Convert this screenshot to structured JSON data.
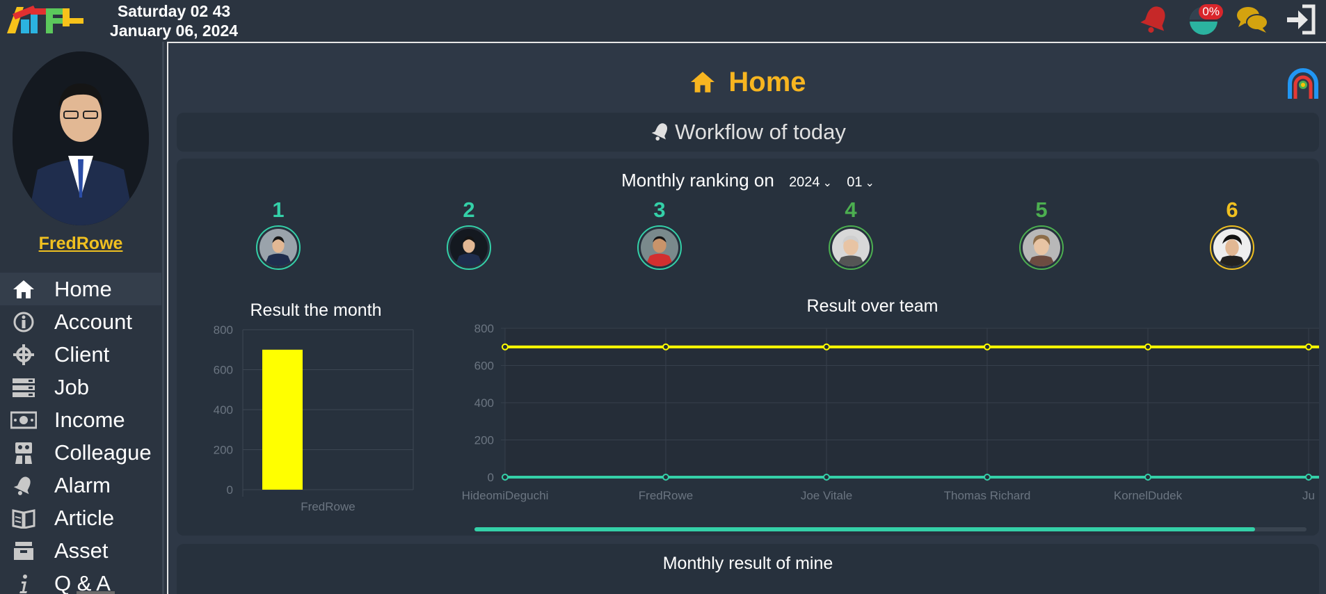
{
  "header": {
    "date_line1": "Saturday 02 43",
    "date_line2": "January 06, 2024",
    "progress_badge": "0%",
    "icons": [
      "bell-icon",
      "progress-pie-icon",
      "chat-icon",
      "logout-icon"
    ],
    "colors": {
      "bell": "#c62828",
      "pie": "#2bb3a0",
      "chat": "#d4a30f"
    }
  },
  "user": {
    "name": "FredRowe"
  },
  "sidebar": {
    "items": [
      {
        "label": "Home",
        "icon": "home-icon",
        "active": true
      },
      {
        "label": "Account",
        "icon": "info-icon"
      },
      {
        "label": "Client",
        "icon": "crosshair-icon"
      },
      {
        "label": "Job",
        "icon": "job-list-icon"
      },
      {
        "label": "Income",
        "icon": "money-icon"
      },
      {
        "label": "Colleague",
        "icon": "colleague-icon"
      },
      {
        "label": "Alarm",
        "icon": "bell-icon"
      },
      {
        "label": "Article",
        "icon": "book-icon"
      },
      {
        "label": "Asset",
        "icon": "box-icon"
      },
      {
        "label": "Q & A",
        "icon": "info-small-icon"
      }
    ]
  },
  "main": {
    "title": "Home",
    "workflow_title": "Workflow of today",
    "ranking": {
      "label": "Monthly ranking on",
      "year": "2024",
      "month": "01",
      "ranks": [
        {
          "rank": "1",
          "color": "#34d0a8"
        },
        {
          "rank": "2",
          "color": "#34d0a8"
        },
        {
          "rank": "3",
          "color": "#34d0a8"
        },
        {
          "rank": "4",
          "color": "#4caf50"
        },
        {
          "rank": "5",
          "color": "#4caf50"
        },
        {
          "rank": "6",
          "color": "#f0c020"
        }
      ]
    },
    "monthly_result_title": "Monthly result of mine"
  },
  "chart_data": [
    {
      "type": "bar",
      "title": "Result the month",
      "categories": [
        "FredRowe"
      ],
      "values": [
        700
      ],
      "ylim": [
        0,
        800
      ],
      "yticks": [
        0,
        200,
        400,
        600,
        800
      ],
      "colors": [
        "#ffff00"
      ],
      "grid": true
    },
    {
      "type": "line",
      "title": "Result over team",
      "categories": [
        "HideomiDeguchi",
        "FredRowe",
        "Joe Vitale",
        "Thomas Richard",
        "KornelDudek",
        "Ju"
      ],
      "series": [
        {
          "values": [
            700,
            700,
            700,
            700,
            700,
            700
          ],
          "color": "#ffff00"
        },
        {
          "values": [
            0,
            0,
            0,
            0,
            0,
            0
          ],
          "color": "#34d0a8"
        }
      ],
      "ylim": [
        0,
        800
      ],
      "yticks": [
        0,
        200,
        400,
        600,
        800
      ],
      "grid": true
    }
  ]
}
